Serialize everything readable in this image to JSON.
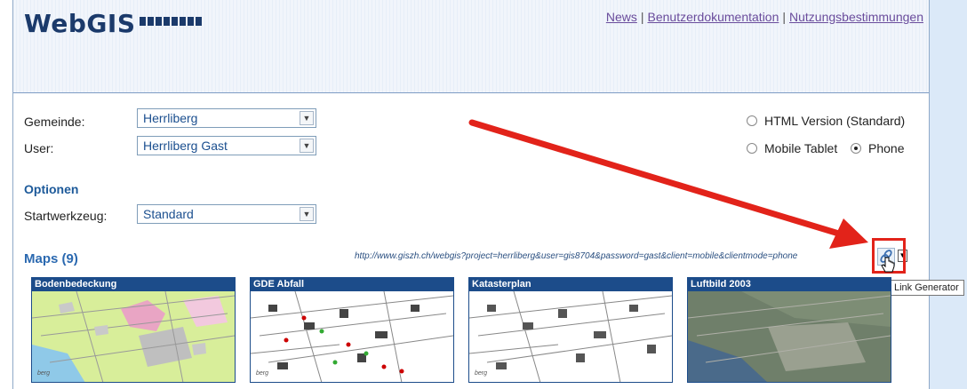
{
  "header": {
    "logo": "WebGIS",
    "links": [
      "News",
      "Benutzerdokumentation",
      "Nutzungsbestimmungen"
    ]
  },
  "form": {
    "gemeinde_label": "Gemeinde:",
    "gemeinde_value": "Herrliberg",
    "user_label": "User:",
    "user_value": "Herrliberg Gast",
    "options_title": "Optionen",
    "startwerkzeug_label": "Startwerkzeug:",
    "startwerkzeug_value": "Standard"
  },
  "client_mode": {
    "html_version": "HTML Version (Standard)",
    "mobile_tablet": "Mobile Tablet",
    "phone": "Phone",
    "selected": "Phone"
  },
  "maps": {
    "title": "Maps (9)",
    "url": "http://www.giszh.ch/webgis?project=herrliberg&user=gis8704&password=gast&client=mobile&clientmode=phone",
    "link_tooltip": "Link Generator",
    "items": [
      {
        "title": "Bodenbedeckung"
      },
      {
        "title": "GDE Abfall"
      },
      {
        "title": "Katasterplan"
      },
      {
        "title": "Luftbild 2003"
      }
    ],
    "thumb_label": "berg"
  },
  "colors": {
    "accent_blue": "#1d5a9a",
    "annotation_red": "#e2231a"
  },
  "icons": [
    "link-icon",
    "chevron-down-icon",
    "hand-cursor-icon"
  ]
}
